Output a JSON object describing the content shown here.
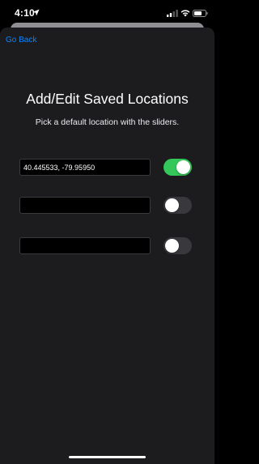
{
  "status_bar": {
    "time": "4:10",
    "icons": [
      "location-arrow-icon",
      "cellular-signal-icon",
      "wifi-icon",
      "battery-icon"
    ]
  },
  "nav": {
    "back_label": "Go Back"
  },
  "page": {
    "title": "Add/Edit Saved Locations",
    "subtitle": "Pick a default location with the sliders."
  },
  "locations": [
    {
      "value": "40.445533, -79.95950",
      "placeholder": "",
      "enabled": true
    },
    {
      "value": "",
      "placeholder": "",
      "enabled": false
    },
    {
      "value": "",
      "placeholder": "",
      "enabled": false
    }
  ],
  "colors": {
    "accent": "#0a84ff",
    "toggle_on": "#34c759",
    "toggle_off": "#39393d",
    "sheet_bg": "#1c1c1e"
  }
}
